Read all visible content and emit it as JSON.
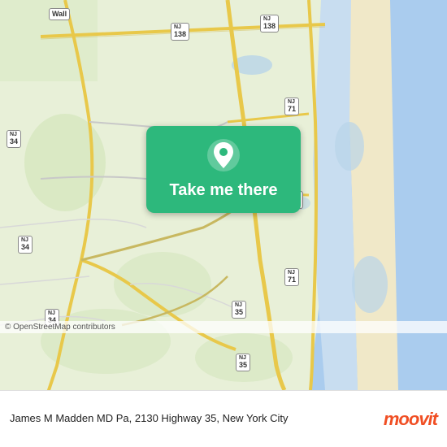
{
  "map": {
    "attribution": "© OpenStreetMap contributors",
    "center": "Wall, NJ area",
    "background_color": "#e8f0d8"
  },
  "button": {
    "label": "Take me there",
    "color": "#2db87c"
  },
  "bottom_bar": {
    "address": "James M Madden MD Pa, 2130 Highway 35, New York City",
    "logo": "moovit"
  },
  "routes": [
    {
      "label": "NJ 34",
      "positions": [
        "left-top",
        "left-mid",
        "left-bottom"
      ]
    },
    {
      "label": "NJ 35",
      "positions": [
        "center-bottom"
      ]
    },
    {
      "label": "NJ 71",
      "positions": [
        "right-mid"
      ]
    },
    {
      "label": "NJ 138",
      "positions": [
        "top-center"
      ]
    },
    {
      "label": "Wall",
      "position": "top-left"
    }
  ],
  "icons": {
    "pin": "location-pin-icon",
    "moovit": "moovit-logo-icon"
  }
}
